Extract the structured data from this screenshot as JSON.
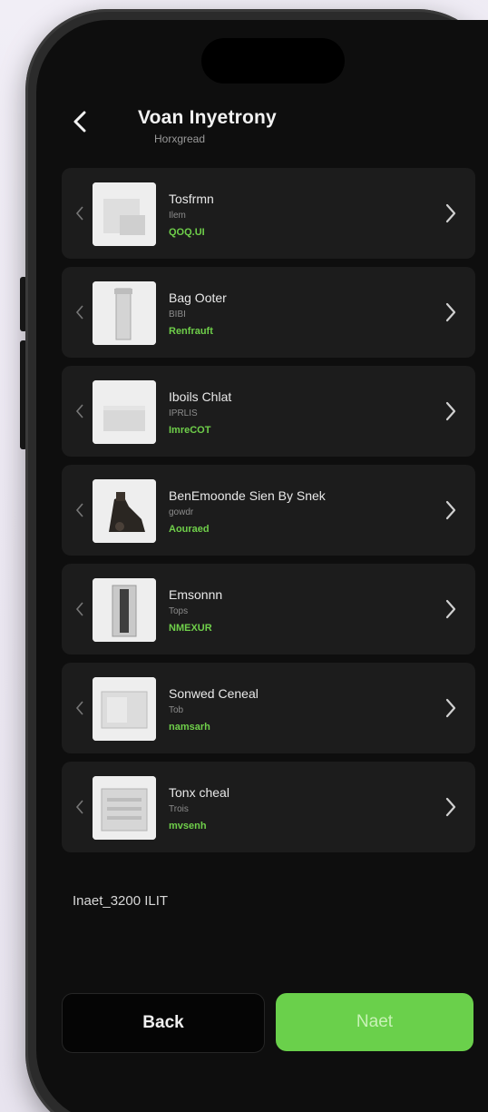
{
  "header": {
    "title": "Voan Inyetrony",
    "subtitle": "Horxgread"
  },
  "items": [
    {
      "name": "Tosfrmn",
      "sub": "Ilem",
      "status": "QOQ.UI"
    },
    {
      "name": "Bag Ooter",
      "sub": "BIBI",
      "status": "Renfrauft"
    },
    {
      "name": "Iboils Chlat",
      "sub": "IPRLIS",
      "status": "ImreCOT"
    },
    {
      "name": "BenEmoonde Sien By Snek",
      "sub": "gowdr",
      "status": "Aouraed"
    },
    {
      "name": "Emsonnn",
      "sub": "Tops",
      "status": "NMEXUR"
    },
    {
      "name": "Sonwed Ceneal",
      "sub": "Tob",
      "status": "namsarh"
    },
    {
      "name": "Tonx cheal",
      "sub": "Trois",
      "status": "mvsenh"
    }
  ],
  "total": "Inaet_3200 ILIT",
  "footer": {
    "back_label": "Back",
    "next_label": "Naet"
  },
  "colors": {
    "accent": "#6ad04b",
    "status": "#6fcf4a",
    "background": "#0e0e0e",
    "card": "#1c1c1c"
  }
}
